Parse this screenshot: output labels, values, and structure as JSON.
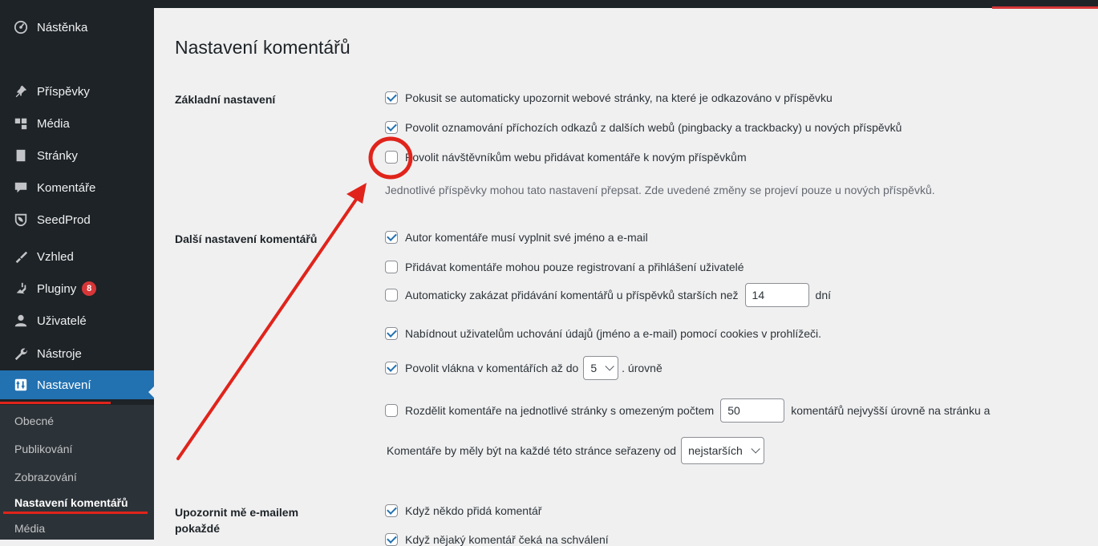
{
  "sidebar": {
    "items": [
      {
        "label": "Nástěnka",
        "icon": "dashboard-icon"
      },
      {
        "label": "Příspěvky",
        "icon": "pin-icon"
      },
      {
        "label": "Média",
        "icon": "media-icon"
      },
      {
        "label": "Stránky",
        "icon": "pages-icon"
      },
      {
        "label": "Komentáře",
        "icon": "comments-icon"
      },
      {
        "label": "SeedProd",
        "icon": "seedprod-icon"
      },
      {
        "label": "Vzhled",
        "icon": "appearance-icon"
      },
      {
        "label": "Pluginy",
        "icon": "plugins-icon",
        "badge": "8"
      },
      {
        "label": "Uživatelé",
        "icon": "users-icon"
      },
      {
        "label": "Nástroje",
        "icon": "tools-icon"
      },
      {
        "label": "Nastavení",
        "icon": "settings-icon",
        "active": true
      }
    ],
    "submenu": [
      "Obecné",
      "Publikování",
      "Zobrazování",
      "Nastavení komentářů",
      "Média"
    ],
    "current_submenu": "Nastavení komentářů"
  },
  "page": {
    "title": "Nastavení komentářů"
  },
  "sections": {
    "basic": {
      "label": "Základní nastavení",
      "options": [
        {
          "label": "Pokusit se automaticky upozornit webové stránky, na které je odkazováno v příspěvku",
          "checked": true
        },
        {
          "label": "Povolit oznamování příchozích odkazů z dalších webů (pingbacky a trackbacky) u nových příspěvků",
          "checked": true
        },
        {
          "label": "Povolit návštěvníkům webu přidávat komentáře k novým příspěvkům",
          "checked": false
        }
      ],
      "description": "Jednotlivé příspěvky mohou tato nastavení přepsat. Zde uvedené změny se projeví pouze u nových příspěvků."
    },
    "other": {
      "label": "Další nastavení komentářů",
      "options": [
        {
          "label": "Autor komentáře musí vyplnit své jméno a e-mail",
          "checked": true
        },
        {
          "label": "Přidávat komentáře mohou pouze registrovaní a přihlášení uživatelé",
          "checked": false
        },
        {
          "label": "Automaticky zakázat přidávání komentářů u příspěvků starších než",
          "checked": false,
          "input_value": "14",
          "suffix": "dní"
        },
        {
          "label": "Nabídnout uživatelům uchování údajů (jméno a e-mail) pomocí cookies v prohlížeči.",
          "checked": true
        },
        {
          "label": "Povolit vlákna v komentářích až do",
          "checked": true,
          "select_value": "5",
          "suffix": ". úrovně"
        },
        {
          "label": "Rozdělit komentáře na jednotlivé stránky s omezeným počtem",
          "checked": false,
          "input_value": "50",
          "suffix": "komentářů nejvyšší úrovně na stránku a"
        }
      ],
      "order_label": "Komentáře by měly být na každé této stránce seřazeny od",
      "order_value": "nejstarších"
    },
    "email": {
      "label_line1": "Upozornit mě e-mailem",
      "label_line2": "pokaždé",
      "options": [
        {
          "label": "Když někdo přidá komentář",
          "checked": true
        },
        {
          "label": "Když nějaký komentář čeká na schválení",
          "checked": true
        }
      ]
    }
  },
  "colors": {
    "accent": "#2271b1",
    "annotation": "#e0241b",
    "sidebar": "#1d2327"
  }
}
